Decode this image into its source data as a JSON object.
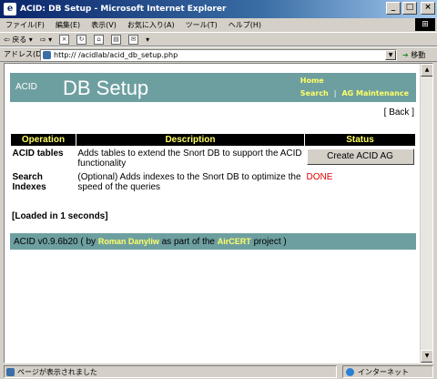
{
  "window": {
    "title": "ACID: DB Setup - Microsoft Internet Explorer",
    "buttons": [
      "_",
      "□",
      "×"
    ]
  },
  "menubar": {
    "items": [
      "ファイル(F)",
      "編集(E)",
      "表示(V)",
      "お気に入り(A)",
      "ツール(T)",
      "ヘルプ(H)"
    ]
  },
  "toolbar": {
    "back_label": "戻る"
  },
  "address": {
    "label": "アドレス(D)",
    "url": "http://                  /acidlab/acid_db_setup.php",
    "go_label": "移動"
  },
  "page": {
    "brand": "ACID",
    "title": "DB Setup",
    "links": {
      "home": "Home",
      "search": "Search",
      "ag_maintenance": "AG Maintenance"
    },
    "back": "[ Back ]",
    "table": {
      "headers": [
        "Operation",
        "Description",
        "Status"
      ],
      "rows": [
        {
          "operation": "ACID tables",
          "description": "Adds tables to extend the Snort DB to support the ACID functionality",
          "status_button": "Create ACID AG"
        },
        {
          "operation": "Search Indexes",
          "description": "(Optional) Adds indexes to the Snort DB to optimize the speed of the queries",
          "status_text": "DONE"
        }
      ]
    },
    "loaded": "[Loaded in 1 seconds]",
    "footer": {
      "prefix": "ACID v0.9.6b20 ( by",
      "author": "Roman Danyliw",
      "middle": "as part of the",
      "project": "AirCERT",
      "suffix": "project )"
    }
  },
  "statusbar": {
    "text": "ページが表示されました",
    "zone": "インターネット"
  },
  "colors": {
    "header_bg": "#6e9fa0",
    "link_yellow": "#ffff66",
    "done_red": "#e00000"
  }
}
